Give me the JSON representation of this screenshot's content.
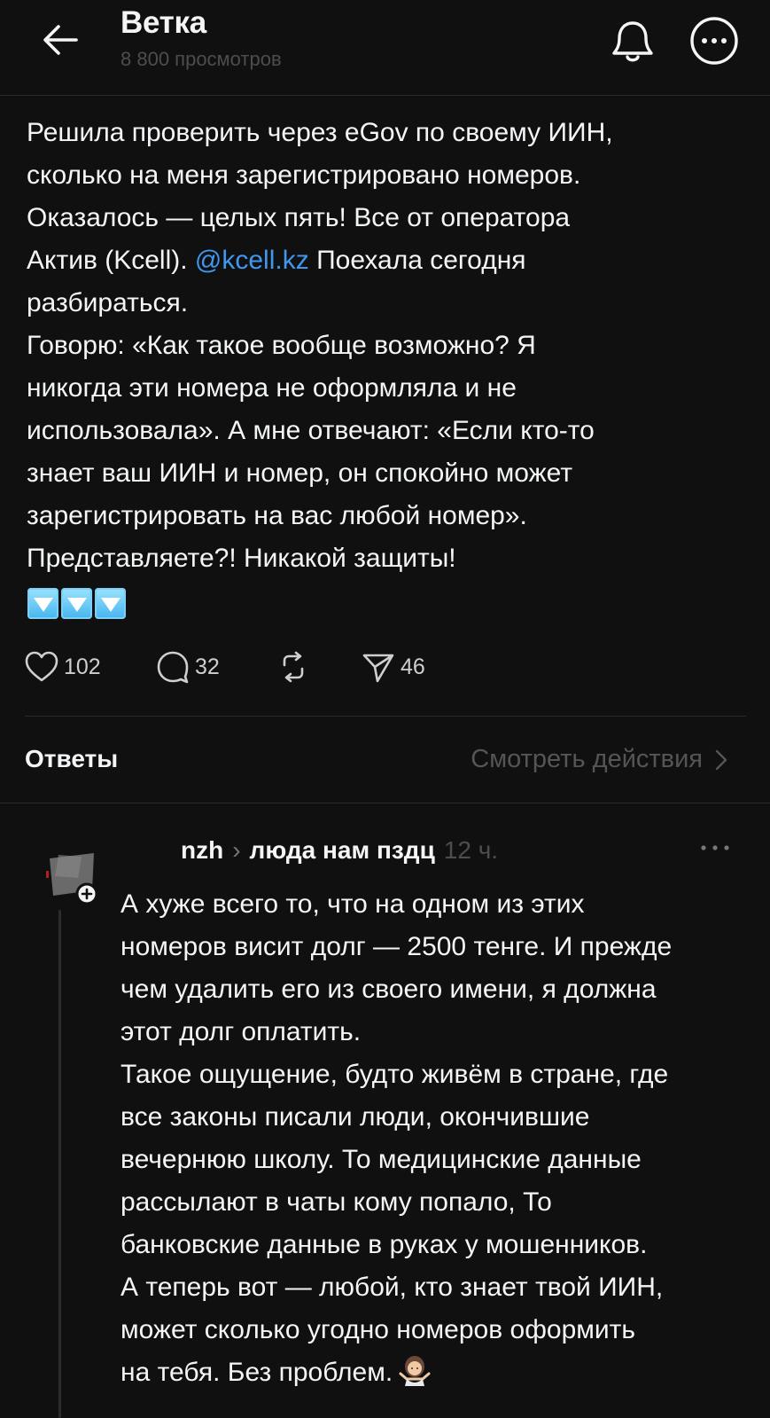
{
  "header": {
    "title": "Ветка",
    "subtitle": "8 800 просмотров"
  },
  "post": {
    "text_before_mention": "Решила проверить через eGov по своему ИИН,\nсколько на меня зарегистрировано номеров.\nОказалось — целых пять! Все от оператора\nАктив (Kcell). ",
    "mention": "@kcell.kz",
    "text_after_mention": " Поехала сегодня\nразбираться.\nГоворю: «Как такое вообще возможно? Я\nникогда эти номера не оформляла и не\nиспользовала». А мне отвечают: «Если кто-то\nзнает ваш ИИН и номер, он спокойно может\nзарегистрировать на вас любой номер».\nПредставляете?! Никакой защиты!",
    "emojis": [
      "down-triangle-key",
      "down-triangle-key",
      "down-triangle-key"
    ],
    "actions": {
      "likes": "102",
      "comments": "32",
      "reposts": "",
      "shares": "46"
    }
  },
  "replies_bar": {
    "label": "Ответы",
    "view_activity": "Смотреть действия"
  },
  "reply": {
    "username": "nzh",
    "replying_to": "люда нам пздц",
    "time": "12 ч.",
    "text": "А хуже всего то, что на одном из этих\nномеров висит долг — 2500 тенге. И прежде\nчем удалить его из своего имени, я должна\nэтот долг оплатить.\nТакое ощущение, будто живём в стране, где\nвсе законы писали люди, окончившие\nвечернюю школу. То медицинские данные\nрассылают в чаты кому попало, То\nбанковские данные в руках у мошенников.\nА теперь вот — любой, кто знает твой ИИН,\nможет сколько угодно номеров оформить\nна тебя. Без проблем.",
    "emoji": "person-shrugging"
  },
  "colors": {
    "background": "#101010",
    "text": "#f3f5f7",
    "muted": "#4d4d4d",
    "link": "#3f97ee"
  }
}
